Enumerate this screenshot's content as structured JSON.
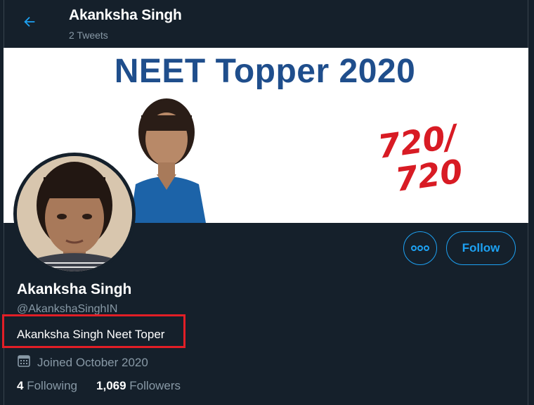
{
  "header": {
    "name": "Akanksha Singh",
    "tweet_count": "2 Tweets"
  },
  "banner": {
    "headline": "NEET Topper 2020",
    "score_line1": "720/",
    "score_line2": "720"
  },
  "profile": {
    "name": "Akanksha Singh",
    "handle": "@AkankshaSinghIN",
    "bio": "Akanksha Singh Neet Toper",
    "joined": "Joined October 2020",
    "following_count": "4",
    "following_label": "Following",
    "followers_count": "1,069",
    "followers_label": "Followers"
  },
  "actions": {
    "follow_label": "Follow",
    "more_icon": "more-icon"
  },
  "colors": {
    "background": "#15202b",
    "accent": "#1da1f2",
    "secondary_text": "#8899a6",
    "highlight_box": "#e21e26"
  }
}
